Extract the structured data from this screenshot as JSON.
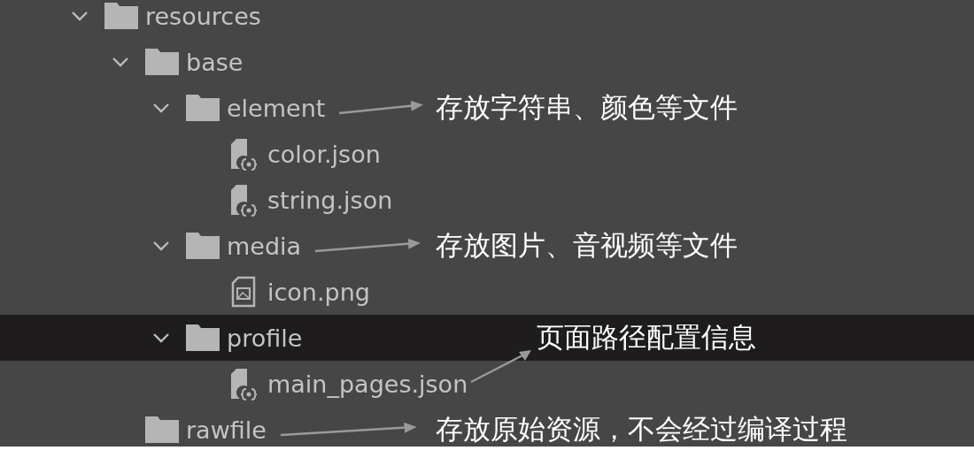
{
  "tree": [
    {
      "label": "resources",
      "kind": "folder",
      "expanded": true,
      "selected": false,
      "children": [
        {
          "label": "base",
          "kind": "folder",
          "expanded": true,
          "selected": false,
          "children": [
            {
              "label": "element",
              "kind": "folder",
              "expanded": true,
              "selected": false,
              "note": {
                "text": "存放字符串、颜色等文件",
                "kind": "inline"
              },
              "children": [
                {
                  "label": "color.json",
                  "kind": "json",
                  "selected": false
                },
                {
                  "label": "string.json",
                  "kind": "json",
                  "selected": false
                }
              ]
            },
            {
              "label": "media",
              "kind": "folder",
              "expanded": true,
              "selected": false,
              "note": {
                "text": "存放图片、音视频等文件",
                "kind": "inline"
              },
              "children": [
                {
                  "label": "icon.png",
                  "kind": "image",
                  "selected": false
                }
              ]
            },
            {
              "label": "profile",
              "kind": "folder",
              "expanded": true,
              "selected": true,
              "children": [
                {
                  "label": "main_pages.json",
                  "kind": "json",
                  "selected": false,
                  "note": {
                    "text": "页面路径配置信息",
                    "kind": "raised"
                  }
                }
              ]
            }
          ]
        },
        {
          "label": "rawfile",
          "kind": "folder",
          "selected": false,
          "note": {
            "text": "存放原始资源，不会经过编译过程",
            "kind": "inline"
          }
        }
      ]
    }
  ]
}
